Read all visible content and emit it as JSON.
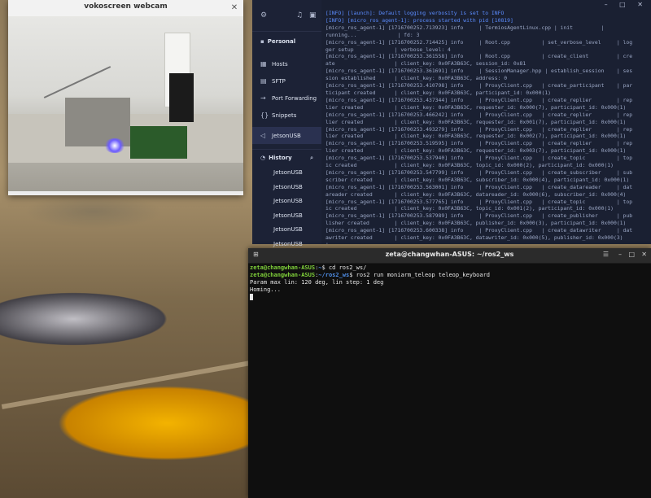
{
  "webcam": {
    "title": "vokoscreen webcam",
    "close_icon": "close-icon"
  },
  "sidenav": {
    "top_icons": [
      "gear-icon",
      "bell-icon",
      "terminal-icon"
    ],
    "section": "Personal",
    "items": [
      {
        "icon": "hosts-icon",
        "glyph": "▦",
        "label": "Hosts"
      },
      {
        "icon": "sftp-icon",
        "glyph": "▤",
        "label": "SFTP"
      },
      {
        "icon": "port-forwarding-icon",
        "glyph": "→",
        "label": "Port Forwarding"
      },
      {
        "icon": "snippets-icon",
        "glyph": "{}",
        "label": "Snippets"
      },
      {
        "icon": "connection-icon",
        "glyph": "◁",
        "label": "JetsonUSB"
      }
    ],
    "history_label": "History",
    "history_items": [
      "JetsonUSB",
      "JetsonUSB",
      "JetsonUSB",
      "JetsonUSB",
      "JetsonUSB",
      "JetsonUSB"
    ]
  },
  "log": {
    "window_buttons": "– □ ✕",
    "lines": [
      "[INFO] [launch]: Default logging verbosity is set to INFO",
      "[INFO] [micro_ros_agent-1]: process started with pid [10819]",
      "[micro_ros_agent-1] [1716700252.713923] info     | TermiosAgentLinux.cpp | init         |",
      "running...             | fd: 3",
      "[micro_ros_agent-1] [1716700252.714425] info     | Root.cpp          | set_verbose_level     | log",
      "ger setup             | verbose_level: 4",
      "[micro_ros_agent-1] [1716700253.361558] info     | Root.cpp          | create_client         | cre",
      "ate                   | client_key: 0x0FA3B63C, session_id: 0x81",
      "[micro_ros_agent-1] [1716700253.361691] info     | SessionManager.hpp | establish_session    | ses",
      "sion established      | client_key: 0x0FA3B63C, address: 0",
      "[micro_ros_agent-1] [1716700253.410798] info     | ProxyClient.cpp   | create_participant    | par",
      "ticipant created      | client_key: 0x0FA3B63C, participant_id: 0x000(1)",
      "[micro_ros_agent-1] [1716700253.437344] info     | ProxyClient.cpp   | create_replier        | rep",
      "lier created          | client_key: 0x0FA3B63C, requester_id: 0x000(7), participant_id: 0x000(1)",
      "[micro_ros_agent-1] [1716700253.466242] info     | ProxyClient.cpp   | create_replier        | rep",
      "lier created          | client_key: 0x0FA3B63C, requester_id: 0x001(7), participant_id: 0x000(1)",
      "[micro_ros_agent-1] [1716700253.493279] info     | ProxyClient.cpp   | create_replier        | rep",
      "lier created          | client_key: 0x0FA3B63C, requester_id: 0x002(7), participant_id: 0x000(1)",
      "[micro_ros_agent-1] [1716700253.519595] info     | ProxyClient.cpp   | create_replier        | rep",
      "lier created          | client_key: 0x0FA3B63C, requester_id: 0x003(7), participant_id: 0x000(1)",
      "[micro_ros_agent-1] [1716700253.537940] info     | ProxyClient.cpp   | create_topic          | top",
      "ic created            | client_key: 0x0FA3B63C, topic_id: 0x000(2), participant_id: 0x000(1)",
      "[micro_ros_agent-1] [1716700253.547799] info     | ProxyClient.cpp   | create_subscriber     | sub",
      "scriber created       | client_key: 0x0FA3B63C, subscriber_id: 0x000(4), participant_id: 0x000(1)",
      "[micro_ros_agent-1] [1716700253.563001] info     | ProxyClient.cpp   | create_datareader     | dat",
      "areader created       | client_key: 0x0FA3B63C, datareader_id: 0x000(6), subscriber_id: 0x000(4)",
      "[micro_ros_agent-1] [1716700253.577765] info     | ProxyClient.cpp   | create_topic          | top",
      "ic created            | client_key: 0x0FA3B63C, topic_id: 0x001(2), participant_id: 0x000(1)",
      "[micro_ros_agent-1] [1716700253.587989] info     | ProxyClient.cpp   | create_publisher      | pub",
      "lisher created        | client_key: 0x0FA3B63C, publisher_id: 0x000(3), participant_id: 0x000(1)",
      "[micro_ros_agent-1] [1716700253.600338] info     | ProxyClient.cpp   | create_datawriter     | dat",
      "awriter created       | client_key: 0x0FA3B63C, datawriter_id: 0x000(5), publisher_id: 0x000(3)",
      "|"
    ]
  },
  "terminal": {
    "title": "zeta@changwhan-ASUS: ~/ros2_ws",
    "new_tab_icon": "new-tab-icon",
    "menu_icon": "hamburger-menu-icon",
    "window_controls": [
      "minimize-icon",
      "maximize-icon",
      "close-icon"
    ],
    "line1_user": "zeta@changwhan-ASUS",
    "line1_path": "~",
    "line1_cmd": "$ cd ros2_ws/",
    "line2_user": "zeta@changwhan-ASUS",
    "line2_path": "~/ros2_ws",
    "line2_cmd": "$ ros2 run moniarm_teleop teleop_keyboard",
    "out1": "Param max lin: 120 deg, lin step: 1 deg",
    "out2": "Homing..."
  }
}
